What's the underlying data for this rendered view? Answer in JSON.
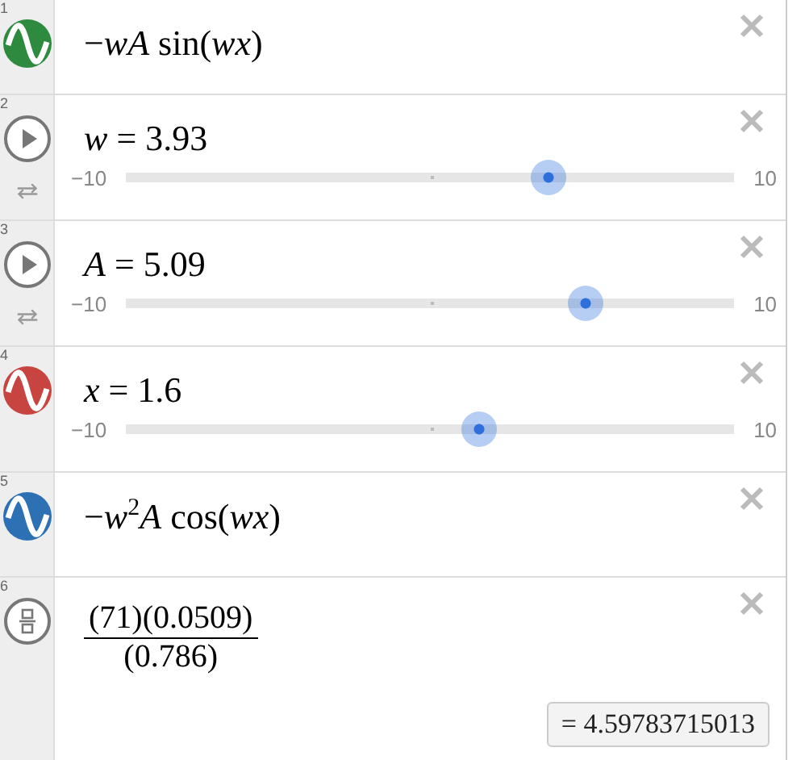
{
  "expressions": [
    {
      "number": "1",
      "kind": "graph",
      "color": "#2d8a3e",
      "latex": "−*wA* sin(*wx*)"
    },
    {
      "number": "2",
      "kind": "slider",
      "latex": "*w* = 3.93",
      "slider": {
        "min": "−10",
        "max": "10",
        "level": 0.696
      }
    },
    {
      "number": "3",
      "kind": "slider",
      "latex": "*A* = 5.09",
      "slider": {
        "min": "−10",
        "max": "10",
        "level": 0.755
      }
    },
    {
      "number": "4",
      "kind": "graph",
      "color": "#c74440",
      "latex": "*x* = 1.6",
      "slider": {
        "min": "−10",
        "max": "10",
        "level": 0.58
      }
    },
    {
      "number": "5",
      "kind": "graph",
      "color": "#2d70b3",
      "latex": "−*w*$^{2}$*A* cos(*wx*)"
    },
    {
      "number": "6",
      "kind": "fraction",
      "numerator": "(71)(0.0509)",
      "denominator": "(0.786)",
      "result": "= 4.59783715013"
    }
  ]
}
